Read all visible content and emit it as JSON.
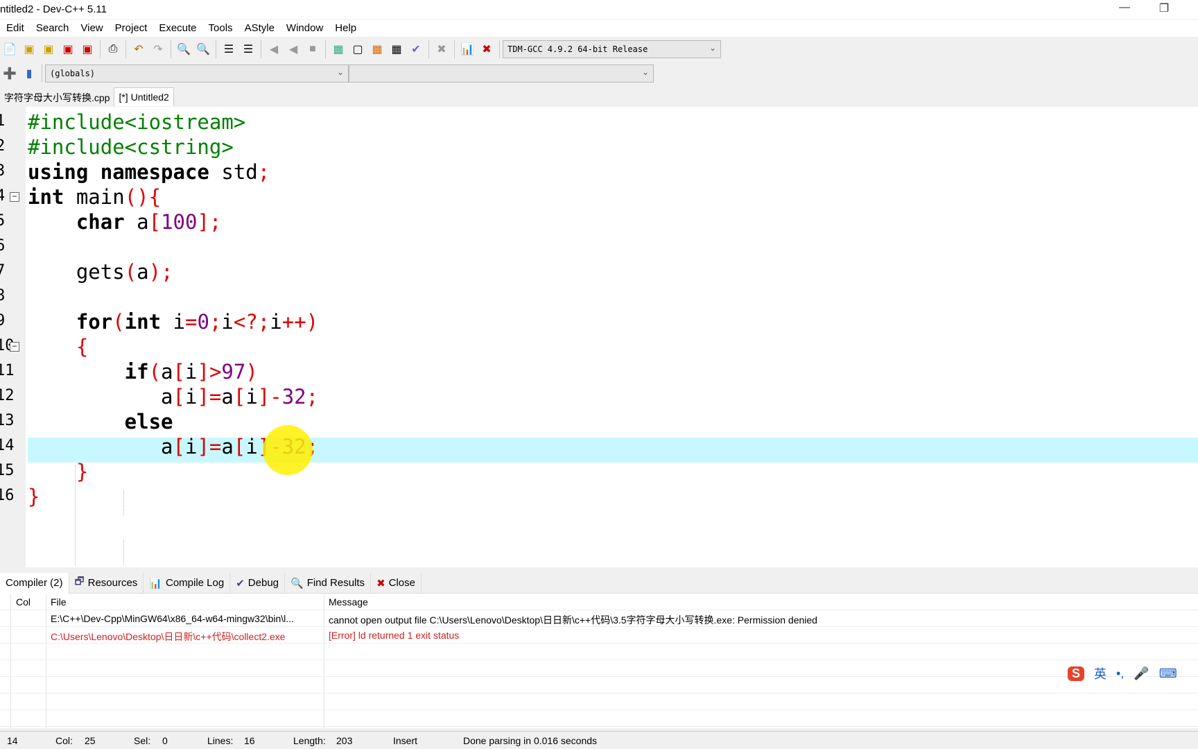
{
  "window": {
    "title": "ntitled2 - Dev-C++ 5.11",
    "minimize": "—",
    "restore": "❐"
  },
  "menu": [
    "Edit",
    "Search",
    "View",
    "Project",
    "Execute",
    "Tools",
    "AStyle",
    "Window",
    "Help"
  ],
  "toolbar": {
    "compiler": "TDM-GCC 4.9.2 64-bit Release",
    "scope": "(globals)",
    "member": ""
  },
  "tabs": [
    {
      "label": "字符字母大小写转换.cpp",
      "active": false
    },
    {
      "label": "[*] Untitled2",
      "active": true
    }
  ],
  "editor": {
    "line_numbers": [
      "1",
      "2",
      "3",
      "4",
      "5",
      "6",
      "7",
      "8",
      "9",
      "10",
      "11",
      "12",
      "13",
      "14",
      "15",
      "16"
    ],
    "current_line": 14,
    "lines": [
      [
        [
          "#include<iostream>",
          "pp"
        ]
      ],
      [
        [
          "#include<cstring>",
          "pp"
        ]
      ],
      [
        [
          "using namespace",
          "kw"
        ],
        [
          " std",
          "nm"
        ],
        [
          ";",
          "sym"
        ]
      ],
      [
        [
          "int",
          "kw"
        ],
        [
          " main",
          "nm"
        ],
        [
          "(){",
          "sym"
        ]
      ],
      [
        [
          "    char",
          "kw"
        ],
        [
          " a",
          "nm"
        ],
        [
          "[",
          "sym"
        ],
        [
          "100",
          "num"
        ],
        [
          "];",
          "sym"
        ]
      ],
      [],
      [
        [
          "    gets",
          "nm"
        ],
        [
          "(",
          "sym"
        ],
        [
          "a",
          "nm"
        ],
        [
          ");",
          "sym"
        ]
      ],
      [],
      [
        [
          "    for",
          "kw"
        ],
        [
          "(",
          "sym"
        ],
        [
          "int",
          "kw"
        ],
        [
          " i",
          "nm"
        ],
        [
          "=",
          "sym"
        ],
        [
          "0",
          "num"
        ],
        [
          ";",
          "sym"
        ],
        [
          "i",
          "nm"
        ],
        [
          "<?;",
          "sym"
        ],
        [
          "i",
          "nm"
        ],
        [
          "++)",
          "sym"
        ]
      ],
      [
        [
          "    {",
          "sym"
        ]
      ],
      [
        [
          "        if",
          "kw"
        ],
        [
          "(",
          "sym"
        ],
        [
          "a",
          "nm"
        ],
        [
          "[",
          "sym"
        ],
        [
          "i",
          "nm"
        ],
        [
          "]>",
          "sym"
        ],
        [
          "97",
          "num"
        ],
        [
          ")",
          "sym"
        ]
      ],
      [
        [
          "           a",
          "nm"
        ],
        [
          "[",
          "sym"
        ],
        [
          "i",
          "nm"
        ],
        [
          "]=",
          "sym"
        ],
        [
          "a",
          "nm"
        ],
        [
          "[",
          "sym"
        ],
        [
          "i",
          "nm"
        ],
        [
          "]-",
          "sym"
        ],
        [
          "32",
          "num"
        ],
        [
          ";",
          "sym"
        ]
      ],
      [
        [
          "        else",
          "kw"
        ]
      ],
      [
        [
          "           a",
          "nm"
        ],
        [
          "[",
          "sym"
        ],
        [
          "i",
          "nm"
        ],
        [
          "]=",
          "sym"
        ],
        [
          "a",
          "nm"
        ],
        [
          "[",
          "sym"
        ],
        [
          "i",
          "nm"
        ],
        [
          "]-",
          "sym"
        ],
        [
          "32",
          "num"
        ],
        [
          ";",
          "sym"
        ]
      ],
      [
        [
          "    }",
          "sym"
        ]
      ],
      [
        [
          "}",
          "sym"
        ]
      ]
    ]
  },
  "bottom_tabs": [
    {
      "label": "Compiler (2)",
      "icon": "compiler-icon"
    },
    {
      "label": "Resources",
      "icon": "resources-icon"
    },
    {
      "label": "Compile Log",
      "icon": "chart-icon"
    },
    {
      "label": "Debug",
      "icon": "check-icon"
    },
    {
      "label": "Find Results",
      "icon": "find-icon"
    },
    {
      "label": "Close",
      "icon": "close-icon"
    }
  ],
  "messages": {
    "headers": {
      "col": "Col",
      "file": "File",
      "message": "Message"
    },
    "rows": [
      {
        "col": "",
        "file": "E:\\C++\\Dev-Cpp\\MinGW64\\x86_64-w64-mingw32\\bin\\l...",
        "message": "cannot open output file C:\\Users\\Lenovo\\Desktop\\日日新\\c++代码\\3.5字符字母大小写转换.exe: Permission denied",
        "error": false
      },
      {
        "col": "",
        "file": "C:\\Users\\Lenovo\\Desktop\\日日新\\c++代码\\collect2.exe",
        "message": "[Error] ld returned 1 exit status",
        "error": true
      }
    ]
  },
  "status": {
    "line": "14",
    "col_label": "Col:",
    "col": "25",
    "sel_label": "Sel:",
    "sel": "0",
    "lines_label": "Lines:",
    "lines": "16",
    "length_label": "Length:",
    "length": "203",
    "mode": "Insert",
    "message": "Done parsing in 0.016 seconds"
  },
  "ime": {
    "lang": "英",
    "punct": "•,"
  },
  "colors": {
    "preprocessor": "#008000",
    "symbol": "#e00000",
    "number": "#800080",
    "current_line": "#c8f8ff",
    "error": "#d02020"
  }
}
